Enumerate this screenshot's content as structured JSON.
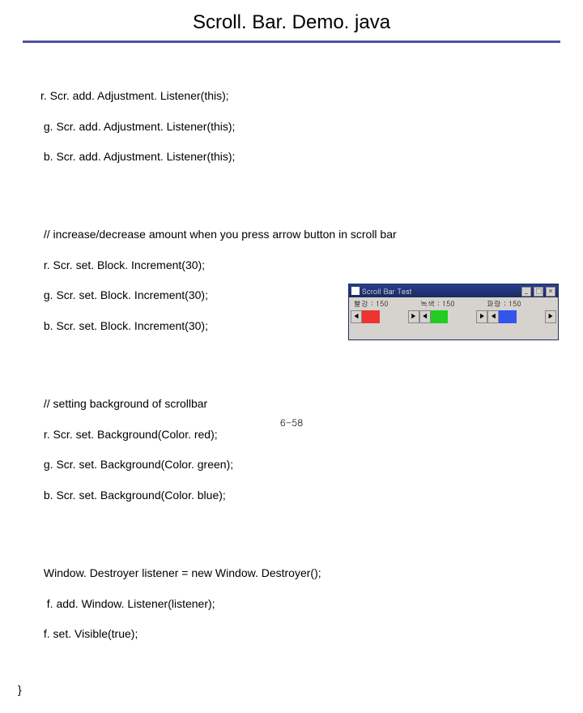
{
  "title": "Scroll. Bar. Demo. java",
  "code": {
    "listeners": [
      "r. Scr. add. Adjustment. Listener(this);",
      " g. Scr. add. Adjustment. Listener(this);",
      " b. Scr. add. Adjustment. Listener(this);"
    ],
    "comment_increment": " // increase/decrease amount when you press arrow button in scroll bar",
    "increment": [
      " r. Scr. set. Block. Increment(30);",
      " g. Scr. set. Block. Increment(30);",
      " b. Scr. set. Block. Increment(30);"
    ],
    "comment_bg": " // setting background of scrollbar",
    "bg": [
      " r. Scr. set. Background(Color. red);",
      " g. Scr. set. Background(Color. green);",
      " b. Scr. set. Background(Color. blue);"
    ],
    "destroyer": [
      " Window. Destroyer listener = new Window. Destroyer();",
      "  f. add. Window. Listener(listener);",
      " f. set. Visible(true);"
    ],
    "close_brace": "}"
  },
  "window": {
    "title": "Scroll Bar Test",
    "labels": {
      "red": "빨강 : 150",
      "green": "녹색 : 150",
      "blue": "파랑 : 150"
    },
    "buttons": {
      "min": "_",
      "max": "□",
      "close": "×"
    },
    "arrows": {
      "left": "◀",
      "right": "▶"
    }
  },
  "page_number": "6-58"
}
